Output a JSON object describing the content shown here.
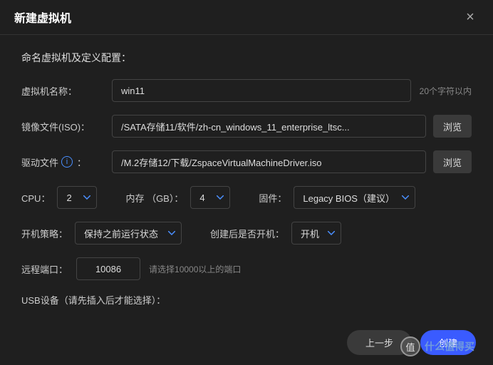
{
  "modal": {
    "title": "新建虚拟机",
    "section_title": "命名虚拟机及定义配置：",
    "name": {
      "label": "虚拟机名称：",
      "value": "win11",
      "limit_hint": "20个字符以内"
    },
    "iso": {
      "label": "镜像文件(ISO)：",
      "value": "/SATA存储11/软件/zh-cn_windows_11_enterprise_ltsc...",
      "browse": "浏览"
    },
    "driver": {
      "label": "驱动文件",
      "colon": "：",
      "value": "/M.2存储12/下载/ZspaceVirtualMachineDriver.iso",
      "browse": "浏览"
    },
    "cpu": {
      "label": "CPU：",
      "value": "2"
    },
    "memory": {
      "label": "内存 （GB）：",
      "value": "4"
    },
    "firmware": {
      "label": "固件：",
      "value": "Legacy BIOS（建议）"
    },
    "boot_policy": {
      "label": "开机策略：",
      "value": "保持之前运行状态"
    },
    "autostart": {
      "label": "创建后是否开机：",
      "value": "开机"
    },
    "port": {
      "label": "远程端口：",
      "value": "10086",
      "hint": "请选择10000以上的端口"
    },
    "usb": {
      "label": "USB设备（请先插入后才能选择）："
    },
    "footer": {
      "prev": "上一步",
      "create": "创建"
    }
  },
  "watermark": {
    "circle": "值",
    "text": "什么值得买"
  }
}
